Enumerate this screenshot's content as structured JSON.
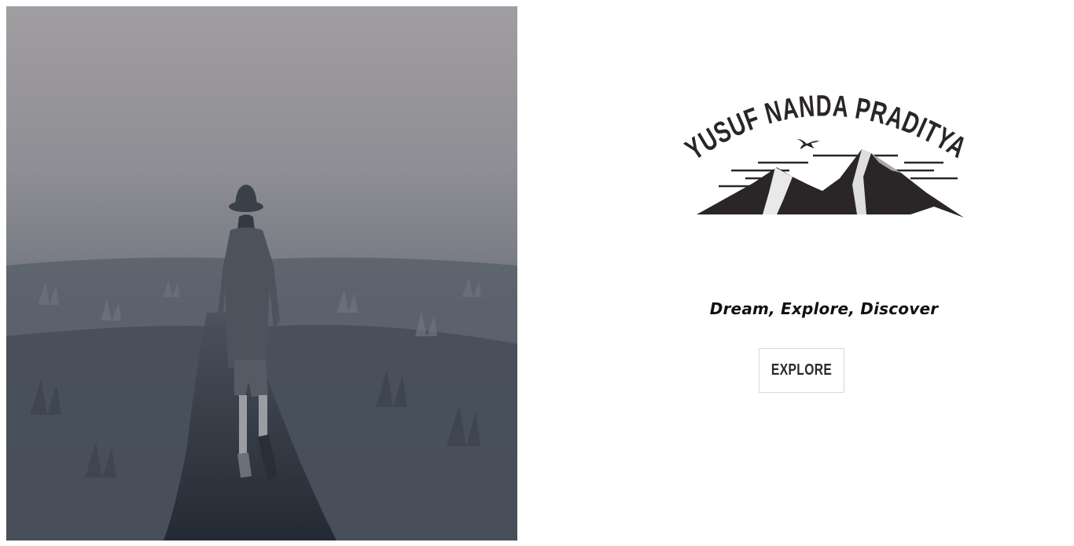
{
  "hero": {
    "image_description_icon": "foggy-trail-hiker-photo"
  },
  "logo": {
    "name": "YUSUF NANDA PRADITYA",
    "icon": "mountain-eagle-logo",
    "ink_color": "#2a2526"
  },
  "tagline": "Dream, Explore, Discover",
  "cta": {
    "label": "EXPLORE"
  }
}
